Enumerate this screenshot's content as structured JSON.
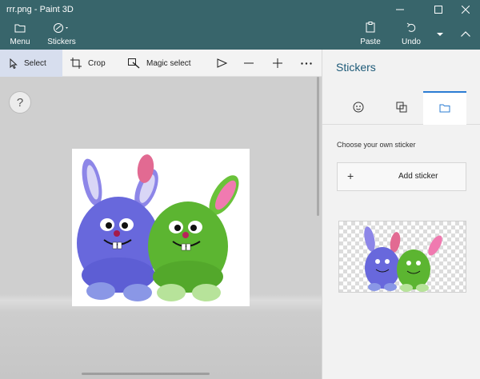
{
  "window": {
    "title": "rrr.png - Paint 3D",
    "controls": [
      "minimize-icon",
      "maximize-icon",
      "close-icon"
    ]
  },
  "commandbar": {
    "menu_label": "Menu",
    "stickers_label": "Stickers",
    "paste_label": "Paste",
    "undo_label": "Undo"
  },
  "toolbar": {
    "select_label": "Select",
    "crop_label": "Crop",
    "magic_select_label": "Magic select"
  },
  "canvas": {
    "help_label": "?"
  },
  "panel": {
    "title": "Stickers",
    "tabs": [
      "stickers-face-icon",
      "shapes-icon",
      "folder-icon"
    ],
    "active_tab": "folder-icon",
    "choose_text": "Choose your own sticker",
    "add_label": "Add sticker",
    "add_plus": "+"
  },
  "colors": {
    "titlebar": "#38656b",
    "accent": "#2b7cd3",
    "select_active": "#d7deee",
    "panel_title": "#1d5a78"
  }
}
